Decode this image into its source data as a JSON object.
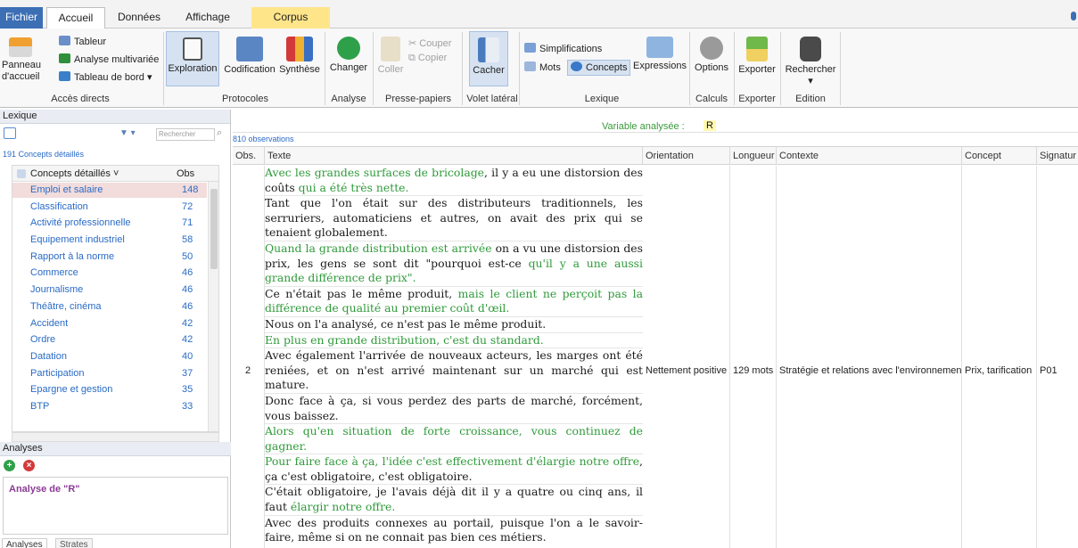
{
  "tabs": {
    "fichier": "Fichier",
    "accueil": "Accueil",
    "donnees": "Données",
    "affichage": "Affichage",
    "corpus": "Corpus"
  },
  "ribbon": {
    "panneau": [
      "Panneau",
      "d'accueil"
    ],
    "tableur": "Tableur",
    "analyse_multi": "Analyse multivariée",
    "tableau_bord": "Tableau de bord ▾",
    "acces_directs": "Accès directs",
    "exploration": "Exploration",
    "codification": "Codification",
    "synthese": "Synthèse",
    "protocoles": "Protocoles",
    "changer": "Changer",
    "analyse": "Analyse",
    "coller": "Coller",
    "couper": "Couper",
    "copier": "Copier",
    "presse_papiers": "Presse-papiers",
    "cacher": "Cacher",
    "volet_lateral": "Volet latéral",
    "simplifications": "Simplifications",
    "mots": "Mots",
    "concepts": "Concepts",
    "expressions": "Expressions",
    "lexique": "Lexique",
    "options": "Options",
    "calculs": "Calculs",
    "exporter_btn": "Exporter",
    "exporter_grp": "Exporter",
    "rechercher": "Rechercher",
    "edition": "Edition"
  },
  "lexique": {
    "title": "Lexique",
    "search_placeholder": "Rechercher",
    "count": "191 Concepts détaillés",
    "col_concept": "Concepts détaillés ˅",
    "col_obs": "Obs",
    "rows": [
      {
        "label": "Emploi et salaire",
        "obs": "148"
      },
      {
        "label": "Classification",
        "obs": "72"
      },
      {
        "label": "Activité professionnelle",
        "obs": "71"
      },
      {
        "label": "Equipement industriel",
        "obs": "58"
      },
      {
        "label": "Rapport à la norme",
        "obs": "50"
      },
      {
        "label": "Commerce",
        "obs": "46"
      },
      {
        "label": "Journalisme",
        "obs": "46"
      },
      {
        "label": "Théâtre, cinéma",
        "obs": "46"
      },
      {
        "label": "Accident",
        "obs": "42"
      },
      {
        "label": "Ordre",
        "obs": "42"
      },
      {
        "label": "Datation",
        "obs": "40"
      },
      {
        "label": "Participation",
        "obs": "37"
      },
      {
        "label": "Epargne et gestion",
        "obs": "35"
      },
      {
        "label": "BTP",
        "obs": "33"
      }
    ]
  },
  "analyses": {
    "title": "Analyses",
    "item": "Analyse de \"R\"",
    "tab1": "Analyses",
    "tab2": "Strates"
  },
  "main": {
    "var_label": "Variable analysée :",
    "var_value": "R",
    "obs_count": "810 observations",
    "columns": {
      "obs": "Obs.",
      "texte": "Texte",
      "orientation": "Orientation",
      "longueur": "Longueur",
      "contexte": "Contexte",
      "concept": "Concept",
      "signature": "Signatur"
    },
    "row": {
      "obs": "2",
      "orientation": "Nettement positive",
      "longueur": "129 mots",
      "contexte": "Stratégie et relations avec l'environnement",
      "concept": "Prix, tarification",
      "signature": "P01"
    },
    "paragraphs": [
      [
        {
          "t": "Avec les grandes surfaces de bricolage",
          "c": "g"
        },
        {
          "t": ", il y a eu une distorsion des coûts ",
          "c": "k"
        },
        {
          "t": "qui a été très nette.",
          "c": "g"
        }
      ],
      [
        {
          "t": "Tant que l'on était sur des distributeurs traditionnels, les serruriers, automaticiens et autres, on avait des prix qui se tenaient globalement.",
          "c": "k"
        }
      ],
      [
        {
          "t": "Quand la grande distribution est arrivée",
          "c": "g"
        },
        {
          "t": " on a vu une distorsion des prix, les gens se sont dit \"pourquoi est-ce ",
          "c": "k"
        },
        {
          "t": "qu'il y a une aussi grande différence de prix\".",
          "c": "g"
        }
      ],
      [
        {
          "t": "Ce n'était pas le même produit, ",
          "c": "k"
        },
        {
          "t": "mais le client ne perçoit pas la différence de qualité au premier coût d'œil.",
          "c": "g"
        }
      ],
      [
        {
          "t": "Nous on l'a analysé, ce n'est pas le même produit.",
          "c": "k"
        }
      ],
      [
        {
          "t": "En plus en grande distribution, c'est du standard.",
          "c": "g"
        }
      ],
      [
        {
          "t": "Avec également l'arrivée de nouveaux acteurs, les marges ont été reniées, et on n'est arrivé maintenant sur un marché qui est mature.",
          "c": "k"
        }
      ],
      [
        {
          "t": "Donc face à ça, si vous perdez des parts de marché, forcément, vous baissez.",
          "c": "k"
        }
      ],
      [
        {
          "t": "Alors qu'en situation de forte croissance, vous continuez de gagner.",
          "c": "g"
        }
      ],
      [
        {
          "t": "Pour faire face à ça, l'idée c'est effectivement d'élargie notre offre",
          "c": "g"
        },
        {
          "t": ", ça c'est obligatoire, c'est obligatoire.",
          "c": "k"
        }
      ],
      [
        {
          "t": "C'était obligatoire, je l'avais déjà dit il y a quatre ou cinq ans, il faut ",
          "c": "k"
        },
        {
          "t": "élargir notre offre.",
          "c": "g"
        }
      ],
      [
        {
          "t": "Avec des produits connexes au portail, puisque l'on a le savoir-faire, même si on ne connait pas bien ces métiers.",
          "c": "k"
        }
      ]
    ]
  }
}
